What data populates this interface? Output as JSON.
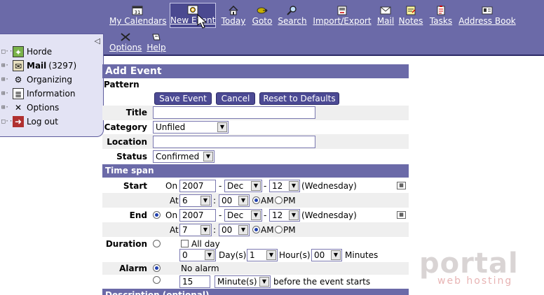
{
  "menu": {
    "items": [
      {
        "label": "My Calendars",
        "icon": "calendar-icon"
      },
      {
        "label": "New Event",
        "icon": "new-event-icon"
      },
      {
        "label": "Today",
        "icon": "house-icon"
      },
      {
        "label": "Goto",
        "icon": "goto-icon"
      },
      {
        "label": "Search",
        "icon": "magnifier-icon"
      },
      {
        "label": "Import/Export",
        "icon": "import-export-icon"
      },
      {
        "label": "Mail",
        "icon": "envelope-icon"
      },
      {
        "label": "Notes",
        "icon": "notes-icon"
      },
      {
        "label": "Tasks",
        "icon": "tasks-icon"
      },
      {
        "label": "Address Book",
        "icon": "address-book-icon"
      },
      {
        "label": "Options",
        "icon": "options-icon"
      },
      {
        "label": "Help",
        "icon": "help-icon"
      }
    ]
  },
  "sidebar": {
    "items": [
      {
        "label": "Horde"
      },
      {
        "label": "Mail",
        "count": "(3297)"
      },
      {
        "label": "Organizing"
      },
      {
        "label": "Information"
      },
      {
        "label": "Options"
      },
      {
        "label": "Log out"
      }
    ]
  },
  "form": {
    "heading": "Add Event",
    "pattern_label": "Pattern",
    "buttons": {
      "save": "Save Event",
      "cancel": "Cancel",
      "reset": "Reset to Defaults"
    },
    "title_label": "Title",
    "title_value": "",
    "category_label": "Category",
    "category_value": "Unfiled",
    "location_label": "Location",
    "location_value": "",
    "status_label": "Status",
    "status_value": "Confirmed",
    "timespan_heading": "Time span",
    "start": {
      "label": "Start",
      "on_label": "On",
      "year": "2007",
      "month": "Dec",
      "day": "12",
      "weekday": "(Wednesday)",
      "at_label": "At",
      "hour": "6",
      "minute": "00",
      "am": "AM",
      "pm": "PM"
    },
    "end": {
      "label": "End",
      "on_label": "On",
      "year": "2007",
      "month": "Dec",
      "day": "12",
      "weekday": "(Wednesday)",
      "at_label": "At",
      "hour": "7",
      "minute": "00",
      "am": "AM",
      "pm": "PM"
    },
    "dash": "-",
    "duration": {
      "label": "Duration",
      "allday": "All day",
      "days": "0",
      "days_label": "Day(s)",
      "hours": "1",
      "hours_label": "Hour(s)",
      "minutes": "00",
      "minutes_label": "Minutes"
    },
    "alarm": {
      "label": "Alarm",
      "no_alarm": "No alarm",
      "value": "15",
      "unit": "Minute(s)",
      "suffix": "before the event starts"
    },
    "description_heading": "Description (optional)"
  },
  "watermark": {
    "line1": "portal",
    "line2": "web hosting"
  },
  "colors": {
    "bar": "#6b6aa8",
    "button": "#4c4a94",
    "radio": "#1f3fae"
  }
}
